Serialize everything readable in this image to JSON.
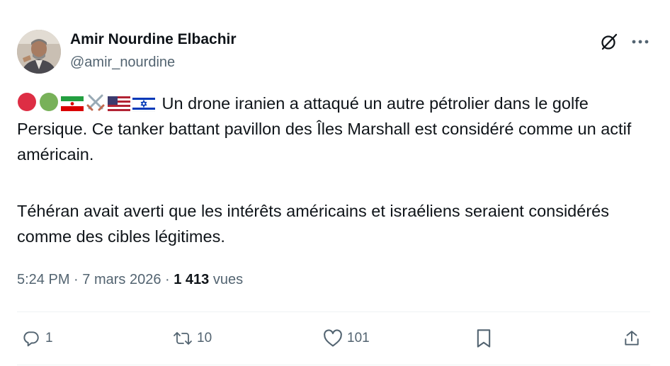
{
  "author": {
    "name": "Amir Nourdine Elbachir",
    "handle": "@amir_nourdine"
  },
  "icons": {
    "grok": "grok-slash-icon",
    "more": "more-dots-icon",
    "emoji_sequence": [
      "red-circle",
      "green-circle",
      "iran-flag",
      "crossed-swords",
      "us-flag",
      "israel-flag"
    ]
  },
  "tweet": {
    "line1_text": "Un drone iranien a attaqué un autre pétrolier dans le golfe Persique. Ce tanker battant pavillon des Îles Marshall est considéré comme un actif américain.",
    "paragraph2": "Téhéran avait averti que les intérêts américains et israéliens seraient considérés comme des cibles légitimes."
  },
  "meta": {
    "time": "5:24 PM",
    "separator1": " · ",
    "date": "7 mars 2026",
    "separator2": " · ",
    "views_count": "1 413",
    "views_label": " vues"
  },
  "actions": {
    "replies": "1",
    "reposts": "10",
    "likes": "101"
  },
  "colors": {
    "text": "#0f1419",
    "secondary": "#536471",
    "divider": "#eff3f4"
  }
}
